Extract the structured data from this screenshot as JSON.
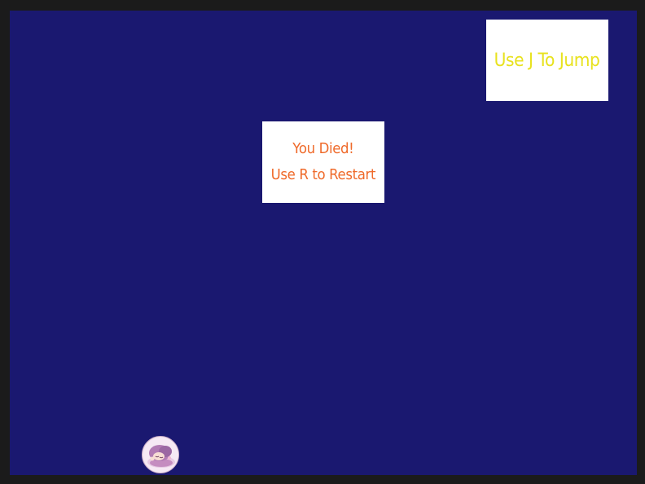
{
  "game": {
    "background_color": "#1a1870",
    "border_color": "#1b1b1b"
  },
  "hint": {
    "text": "Use J To Jump",
    "color": "#e8e21e"
  },
  "death_message": {
    "title": "You Died!",
    "subtitle": "Use R to Restart",
    "color": "#ef6a2a"
  },
  "player": {
    "icon": "sleeping-girl-avatar-icon"
  }
}
